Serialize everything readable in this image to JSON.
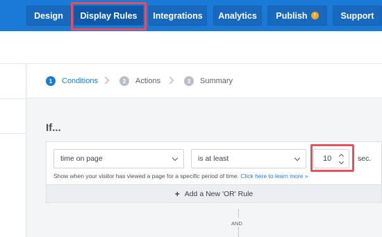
{
  "nav": {
    "items": [
      {
        "label": "Design"
      },
      {
        "label": "Display Rules"
      },
      {
        "label": "Integrations"
      },
      {
        "label": "Analytics"
      },
      {
        "label": "Publish"
      },
      {
        "label": "Support"
      }
    ],
    "publish_badge": "!"
  },
  "steps": [
    {
      "num": "1",
      "label": "Conditions"
    },
    {
      "num": "2",
      "label": "Actions"
    },
    {
      "num": "3",
      "label": "Summary"
    }
  ],
  "rule": {
    "title": "If...",
    "condition_select": "time on page",
    "operator_select": "is at least",
    "value": "10",
    "unit": "sec.",
    "help_text": "Show when your visitor has viewed a page for a specific period of time.",
    "help_link": "Click here to learn more »",
    "add_or_label": "Add a New 'OR' Rule",
    "add_or_icon": "+",
    "and_label": "AND"
  },
  "colors": {
    "nav_bg": "#1b7ad6",
    "highlight": "#e4505e",
    "accent": "#1b7ad6"
  }
}
